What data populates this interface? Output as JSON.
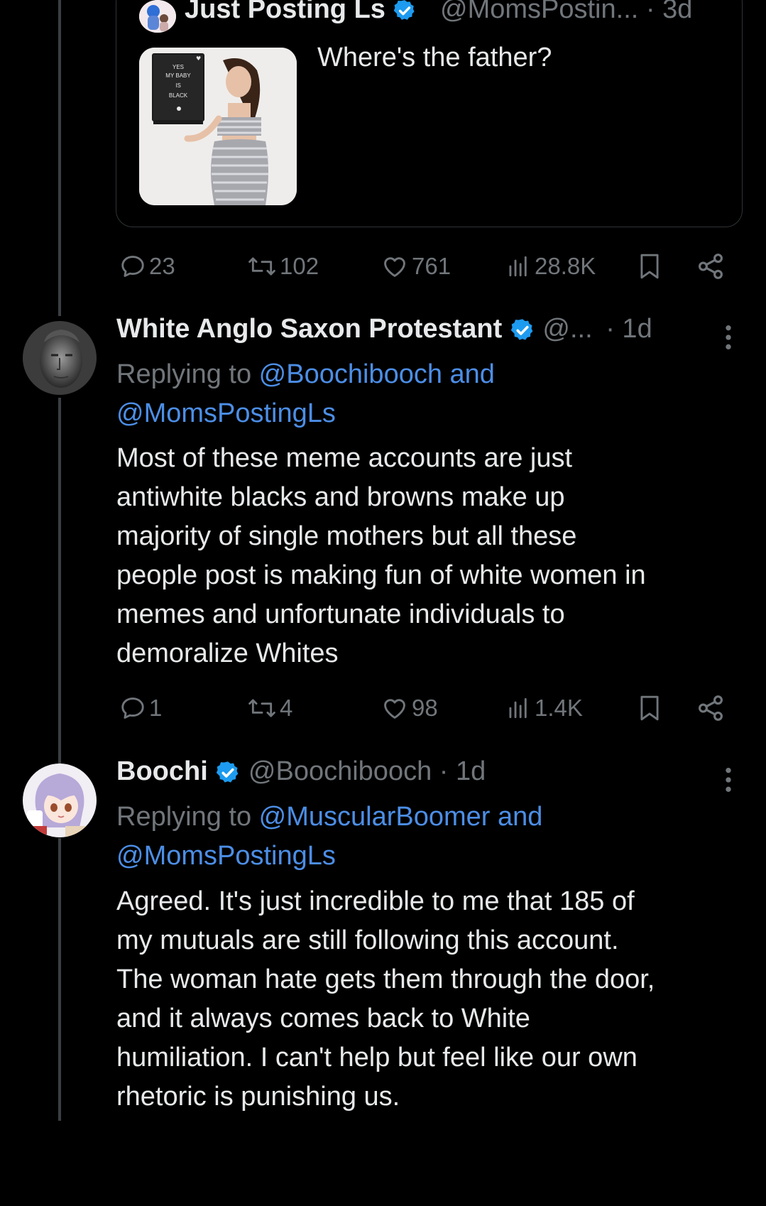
{
  "quoted_tweet": {
    "display_name": "Just Posting Ls",
    "handle": "@MomsPostin...",
    "time": "· 3d",
    "text": "Where's the father?",
    "image_sign_text": "YES MY BABY IS BLACK"
  },
  "main_tweet_actions": {
    "replies": "23",
    "reposts": "102",
    "likes": "761",
    "views": "28.8K"
  },
  "reply_1": {
    "display_name": "White Anglo Saxon Protestant",
    "handle": "@...",
    "time": "· 1d",
    "replying_to_prefix": "Replying to ",
    "replying_to_user1": "@Boochibooch and",
    "replying_to_user2": "@MomsPostingLs",
    "body_lines": [
      "Most of these meme accounts are just",
      "antiwhite blacks and browns make up",
      "majority of single mothers but all these",
      "people post is making fun of white women in",
      "memes and unfortunate individuals to",
      "demoralize Whites"
    ],
    "actions": {
      "replies": "1",
      "reposts": "4",
      "likes": "98",
      "views": "1.4K"
    }
  },
  "reply_2": {
    "display_name": "Boochi",
    "handle": "@Boochibooch",
    "time": "· 1d",
    "replying_to_prefix": "Replying to ",
    "replying_to_user1": "@MuscularBoomer and",
    "replying_to_user2": "@MomsPostingLs",
    "body_lines": [
      "Agreed. It's just incredible to me that 185 of",
      "my mutuals are still following this account.",
      "The woman hate gets them through the door,",
      "and it always comes back to White",
      "humiliation. I can't help but feel like our own",
      "rhetoric is punishing us."
    ]
  },
  "colors": {
    "background": "#000000",
    "text": "#e7e9ea",
    "muted": "#71767b",
    "link": "#4c8ee6",
    "verified": "#1d9bf0",
    "thread_line": "#3b3f44"
  },
  "icons": [
    "reply-icon",
    "repost-icon",
    "like-icon",
    "views-icon",
    "bookmark-icon",
    "share-icon",
    "verified-badge-icon",
    "more-icon"
  ]
}
